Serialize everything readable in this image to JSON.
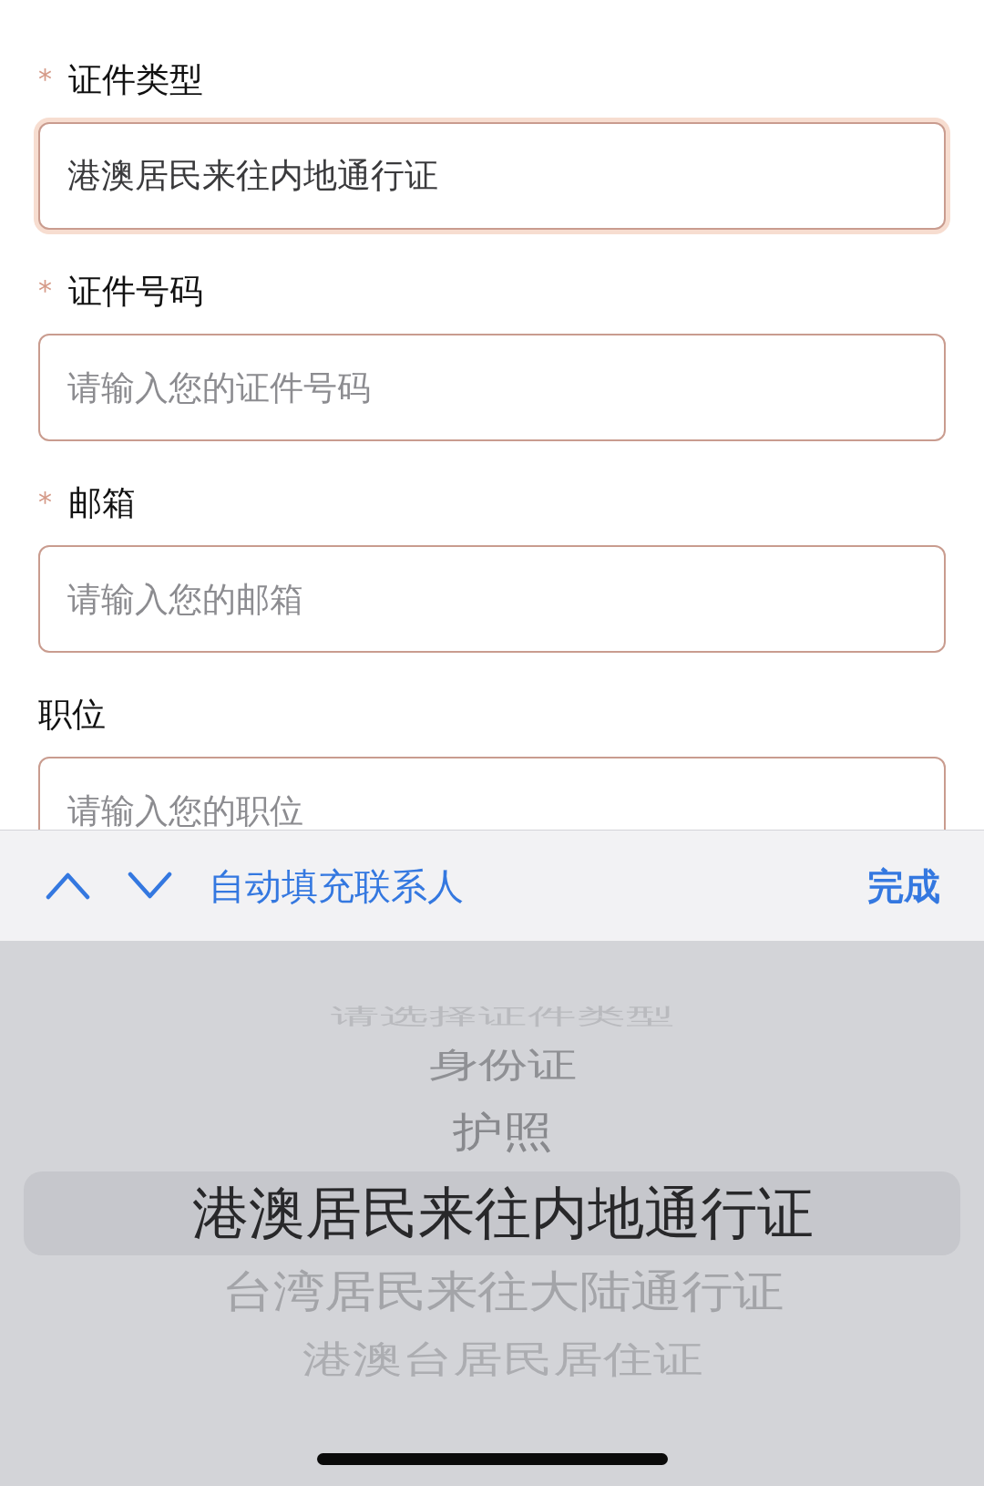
{
  "form": {
    "fields": [
      {
        "required_mark": "*",
        "label": "证件类型",
        "value": "港澳居民来往内地通行证",
        "focused": true
      },
      {
        "required_mark": "*",
        "label": "证件号码",
        "placeholder": "请输入您的证件号码",
        "focused": false
      },
      {
        "required_mark": "*",
        "label": "邮箱",
        "placeholder": "请输入您的邮箱",
        "focused": false
      },
      {
        "label": "职位",
        "placeholder": "请输入您的职位",
        "focused": false
      }
    ]
  },
  "keyboard_toolbar": {
    "autofill_label": "自动填充联系人",
    "done_label": "完成"
  },
  "picker": {
    "options": [
      {
        "label": "请选择证件类型",
        "selected": false
      },
      {
        "label": "身份证",
        "selected": false
      },
      {
        "label": "护照",
        "selected": false
      },
      {
        "label": "港澳居民来往内地通行证",
        "selected": true
      },
      {
        "label": "台湾居民来往大陆通行证",
        "selected": false
      },
      {
        "label": "港澳台居民居住证",
        "selected": false
      }
    ]
  }
}
